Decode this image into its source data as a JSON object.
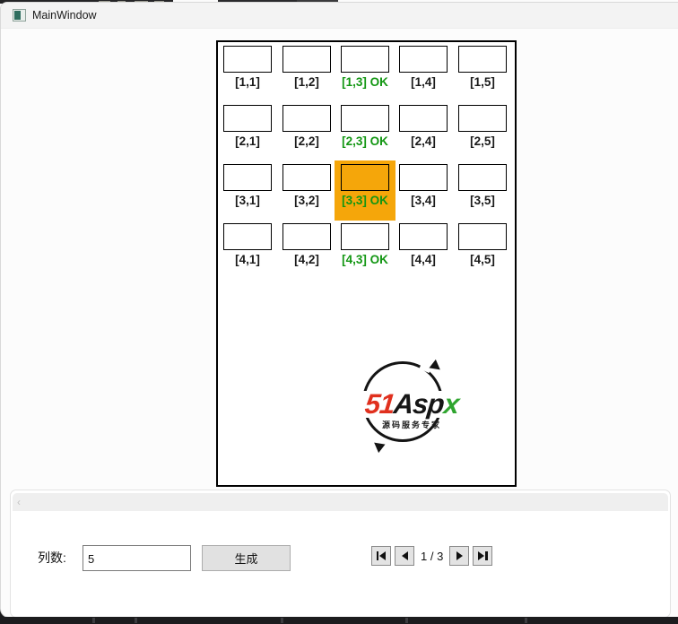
{
  "window": {
    "title": "MainWindow"
  },
  "grid": {
    "rows": [
      {
        "cells": [
          {
            "label": "[1,1]"
          },
          {
            "label": "[1,2]"
          },
          {
            "label": "[1,3] OK",
            "status": "ok"
          },
          {
            "label": "[1,4]"
          },
          {
            "label": "[1,5]"
          }
        ]
      },
      {
        "cells": [
          {
            "label": "[2,1]"
          },
          {
            "label": "[2,2]"
          },
          {
            "label": "[2,3] OK",
            "status": "ok"
          },
          {
            "label": "[2,4]"
          },
          {
            "label": "[2,5]"
          }
        ]
      },
      {
        "cells": [
          {
            "label": "[3,1]"
          },
          {
            "label": "[3,2]"
          },
          {
            "label": "[3,3] OK",
            "status": "ok",
            "selected": true
          },
          {
            "label": "[3,4]"
          },
          {
            "label": "[3,5]"
          }
        ]
      },
      {
        "cells": [
          {
            "label": "[4,1]"
          },
          {
            "label": "[4,2]"
          },
          {
            "label": "[4,3] OK",
            "status": "ok"
          },
          {
            "label": "[4,4]"
          },
          {
            "label": "[4,5]"
          }
        ]
      }
    ]
  },
  "logo": {
    "part_51": "51",
    "part_asp": "Asp",
    "part_x": "x",
    "subtitle": "源码服务专家"
  },
  "panel": {
    "chevron_left_icon": "‹",
    "columns_label": "列数:",
    "columns_value": "5",
    "generate_button": "生成",
    "page_indicator": "1 / 3"
  },
  "colors": {
    "highlight_orange": "#F5A60A",
    "ok_green": "#129612",
    "logo_red": "#E0301E",
    "logo_green": "#2FA52F"
  }
}
